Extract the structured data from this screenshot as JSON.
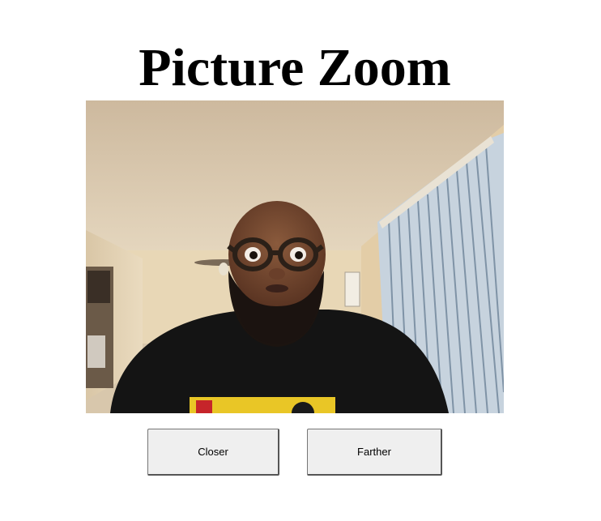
{
  "page": {
    "title": "Picture Zoom"
  },
  "photo": {
    "subject": "man-with-glasses-and-beard-selfie"
  },
  "controls": {
    "closer_label": "Closer",
    "farther_label": "Farther"
  }
}
